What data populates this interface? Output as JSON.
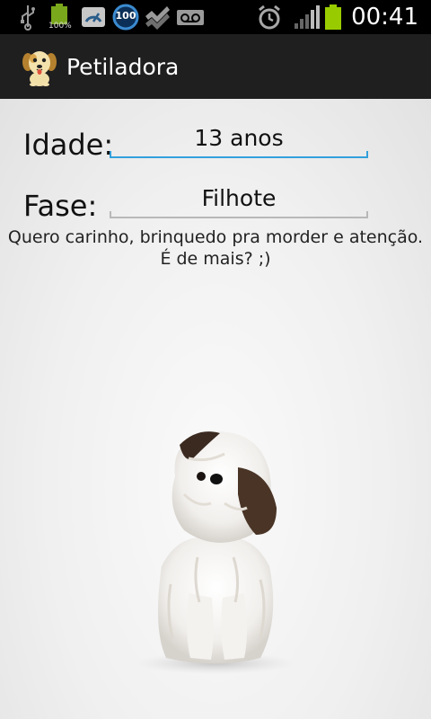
{
  "status_bar": {
    "time": "00:41",
    "battery_small_label": "100%",
    "badge_number": "100",
    "icons": [
      "usb-icon",
      "battery-full-icon",
      "speed-icon",
      "circle-100-icon",
      "checkmark-icon",
      "voicemail-icon",
      "alarm-icon",
      "signal-icon",
      "battery-icon"
    ]
  },
  "action_bar": {
    "title": "Petiladora",
    "icon": "dog-icon"
  },
  "form": {
    "age_label": "Idade:",
    "age_value": "13 anos",
    "phase_label": "Fase:",
    "phase_value": "Filhote"
  },
  "description": "Quero carinho, brinquedo pra morder e atenção. É de mais? ;)",
  "colors": {
    "accent": "#33a0dc",
    "battery_green": "#99cc00",
    "actionbar": "#1f1f1f"
  }
}
